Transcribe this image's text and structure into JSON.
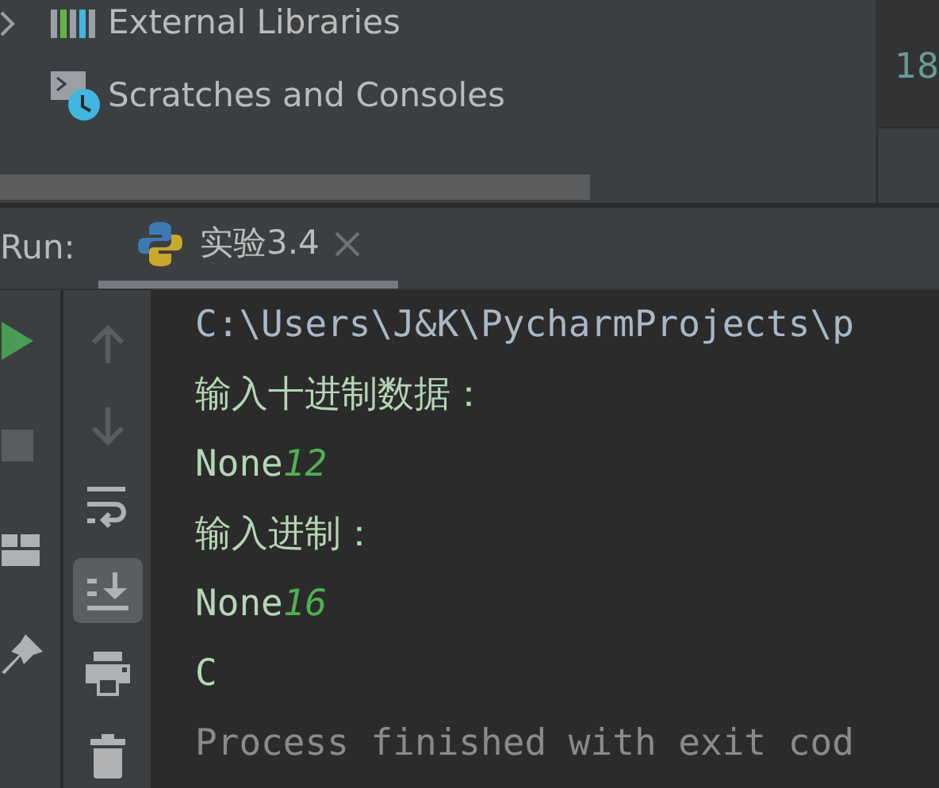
{
  "project_tree": {
    "items": [
      {
        "label": "External Libraries",
        "kind": "libraries",
        "expanded": false
      },
      {
        "label": "Scratches and Consoles",
        "kind": "scratches"
      }
    ]
  },
  "editor": {
    "line_numbers": [
      "18"
    ]
  },
  "run_panel": {
    "title": "Run:",
    "tabs": [
      {
        "label": "实验3.4",
        "selected": true
      }
    ],
    "left_toolbar": [
      {
        "kind": "run",
        "disabled": false
      },
      {
        "kind": "stop",
        "disabled": true
      },
      {
        "kind": "layout",
        "disabled": false
      },
      {
        "kind": "pin",
        "disabled": false
      }
    ],
    "side_toolbar": [
      {
        "kind": "up",
        "disabled": true,
        "on": false
      },
      {
        "kind": "down",
        "disabled": true,
        "on": false
      },
      {
        "kind": "wrap",
        "disabled": false,
        "on": false
      },
      {
        "kind": "scroll-end",
        "disabled": false,
        "on": true
      },
      {
        "kind": "print",
        "disabled": false,
        "on": false
      },
      {
        "kind": "trash",
        "disabled": false,
        "on": false
      }
    ],
    "console": [
      {
        "kind": "command",
        "text": "C:\\Users\\J&K\\PycharmProjects\\p"
      },
      {
        "kind": "output",
        "text": "输入十进制数据："
      },
      {
        "kind": "input",
        "text": "None",
        "input": "12"
      },
      {
        "kind": "output",
        "text": "输入进制："
      },
      {
        "kind": "input",
        "text": "None",
        "input": "16"
      },
      {
        "kind": "output",
        "text": "C"
      },
      {
        "kind": "system",
        "text": "Process finished with exit cod"
      }
    ]
  }
}
